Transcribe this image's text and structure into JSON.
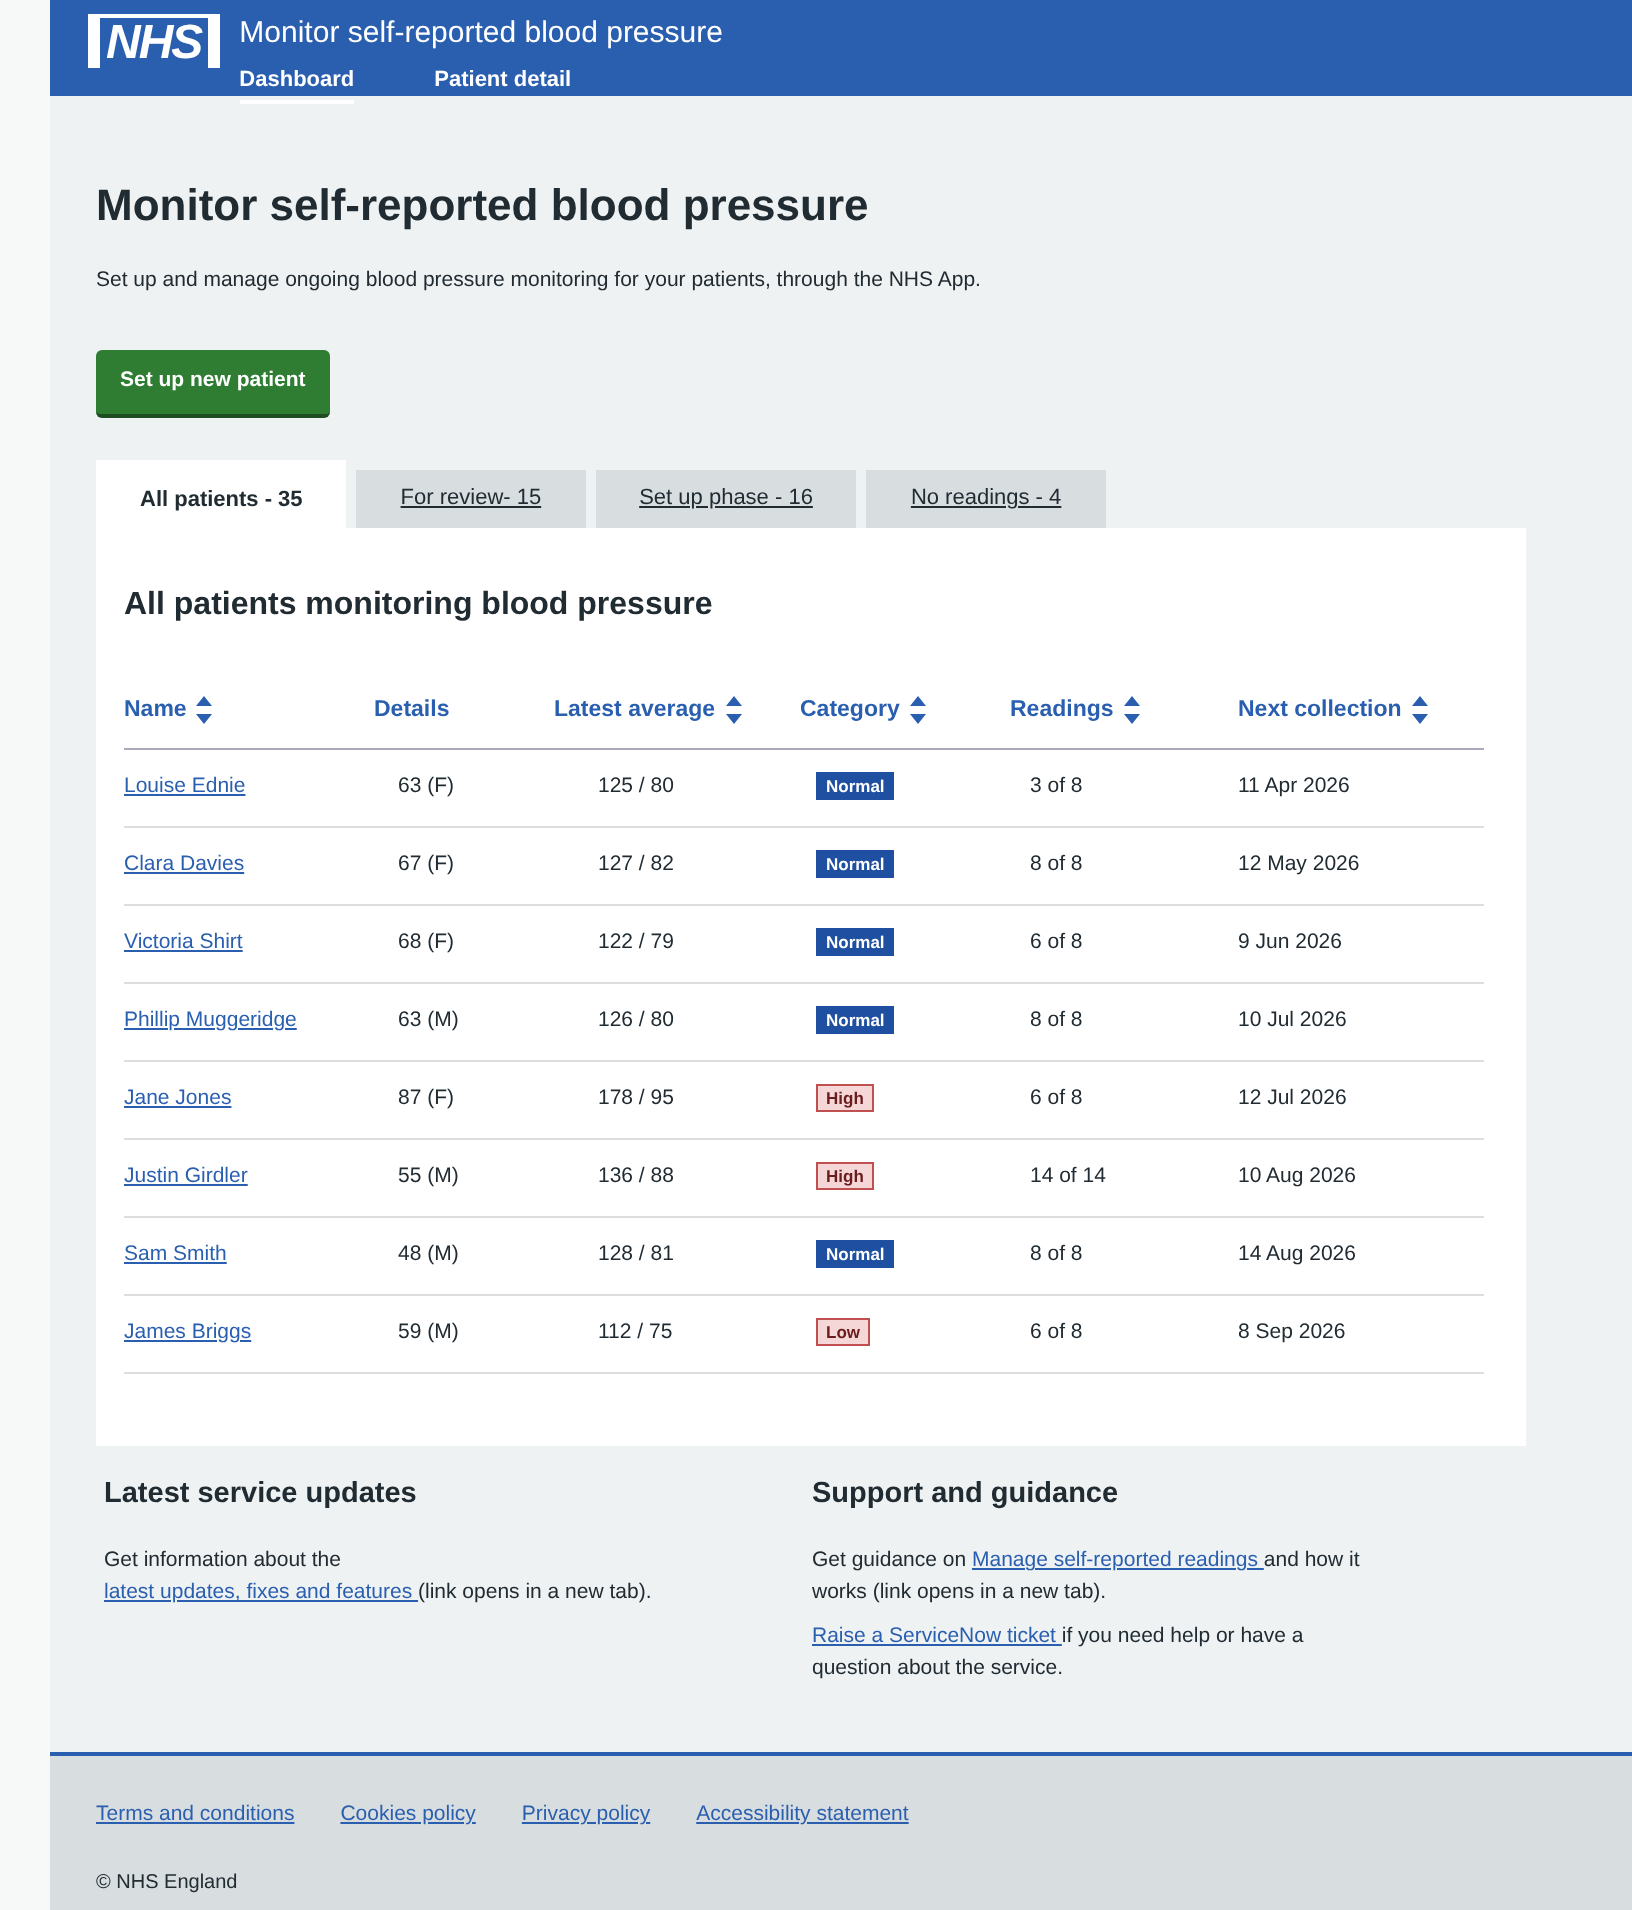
{
  "header": {
    "logo": "NHS",
    "title": "Monitor self-reported blood pressure",
    "nav": [
      {
        "label": "Dashboard",
        "selected": true
      },
      {
        "label": "Patient detail",
        "selected": false
      }
    ]
  },
  "page": {
    "heading": "Monitor self-reported blood pressure",
    "intro": "Set up and manage ongoing blood pressure monitoring for your patients, through the NHS App.",
    "button": "Set up new patient"
  },
  "tabs": [
    {
      "label": "All patients - 35",
      "selected": true
    },
    {
      "label": "For review- 15",
      "selected": false
    },
    {
      "label": "Set up phase - 16",
      "selected": false
    },
    {
      "label": "No readings - 4",
      "selected": false
    }
  ],
  "table": {
    "title": "All patients monitoring blood pressure",
    "columns": [
      {
        "label": "Name",
        "sortable": true
      },
      {
        "label": "Details",
        "sortable": false
      },
      {
        "label": "Latest average",
        "sortable": true
      },
      {
        "label": "Category",
        "sortable": true
      },
      {
        "label": "Readings",
        "sortable": true
      },
      {
        "label": "Next collection",
        "sortable": true
      }
    ],
    "rows": [
      {
        "name": "Louise Ednie",
        "details": "63 (F)",
        "average": "125 / 80",
        "category": {
          "label": "Normal",
          "kind": "normal"
        },
        "readings": "3 of 8",
        "next": "11 Apr 2026"
      },
      {
        "name": "Clara Davies",
        "details": "67 (F)",
        "average": "127 / 82",
        "category": {
          "label": "Normal",
          "kind": "normal"
        },
        "readings": "8 of 8",
        "next": "12 May 2026"
      },
      {
        "name": "Victoria Shirt",
        "details": "68 (F)",
        "average": "122 / 79",
        "category": {
          "label": "Normal",
          "kind": "normal"
        },
        "readings": "6 of 8",
        "next": "9 Jun 2026"
      },
      {
        "name": "Phillip Muggeridge",
        "details": "63 (M)",
        "average": "126 / 80",
        "category": {
          "label": "Normal",
          "kind": "normal"
        },
        "readings": "8 of 8",
        "next": "10 Jul 2026"
      },
      {
        "name": "Jane Jones",
        "details": "87 (F)",
        "average": "178 / 95",
        "category": {
          "label": "High",
          "kind": "high"
        },
        "readings": "6 of 8",
        "next": "12 Jul 2026"
      },
      {
        "name": "Justin Girdler",
        "details": "55 (M)",
        "average": "136 / 88",
        "category": {
          "label": "High",
          "kind": "high"
        },
        "readings": "14 of 14",
        "next": "10 Aug 2026"
      },
      {
        "name": "Sam Smith",
        "details": "48 (M)",
        "average": "128 / 81",
        "category": {
          "label": "Normal",
          "kind": "normal"
        },
        "readings": "8 of 8",
        "next": "14 Aug 2026"
      },
      {
        "name": "James Briggs",
        "details": "59 (M)",
        "average": "112 / 75",
        "category": {
          "label": "Low",
          "kind": "low"
        },
        "readings": "6 of 8",
        "next": "8 Sep 2026"
      }
    ]
  },
  "sections": [
    {
      "heading": "Latest service updates",
      "paragraphs": [
        [
          {
            "kind": "text",
            "text": "Get information about the "
          },
          {
            "kind": "link",
            "text": "latest updates, fixes and features "
          },
          {
            "kind": "text",
            "text": "(link opens in a new tab)."
          }
        ]
      ]
    },
    {
      "heading": "Support and guidance",
      "paragraphs": [
        [
          {
            "kind": "text",
            "text": "Get guidance on "
          },
          {
            "kind": "link",
            "text": "Manage self-reported readings "
          },
          {
            "kind": "text",
            "text": "and how it works (link opens in a new tab)."
          }
        ],
        [
          {
            "kind": "link",
            "text": "Raise a ServiceNow ticket "
          },
          {
            "kind": "text",
            "text": "if you need help or have a question about the service."
          }
        ]
      ]
    }
  ],
  "footer": {
    "links": [
      "Terms and conditions",
      "Cookies policy",
      "Privacy policy",
      "Accessibility statement"
    ],
    "copyright": "© NHS England"
  }
}
